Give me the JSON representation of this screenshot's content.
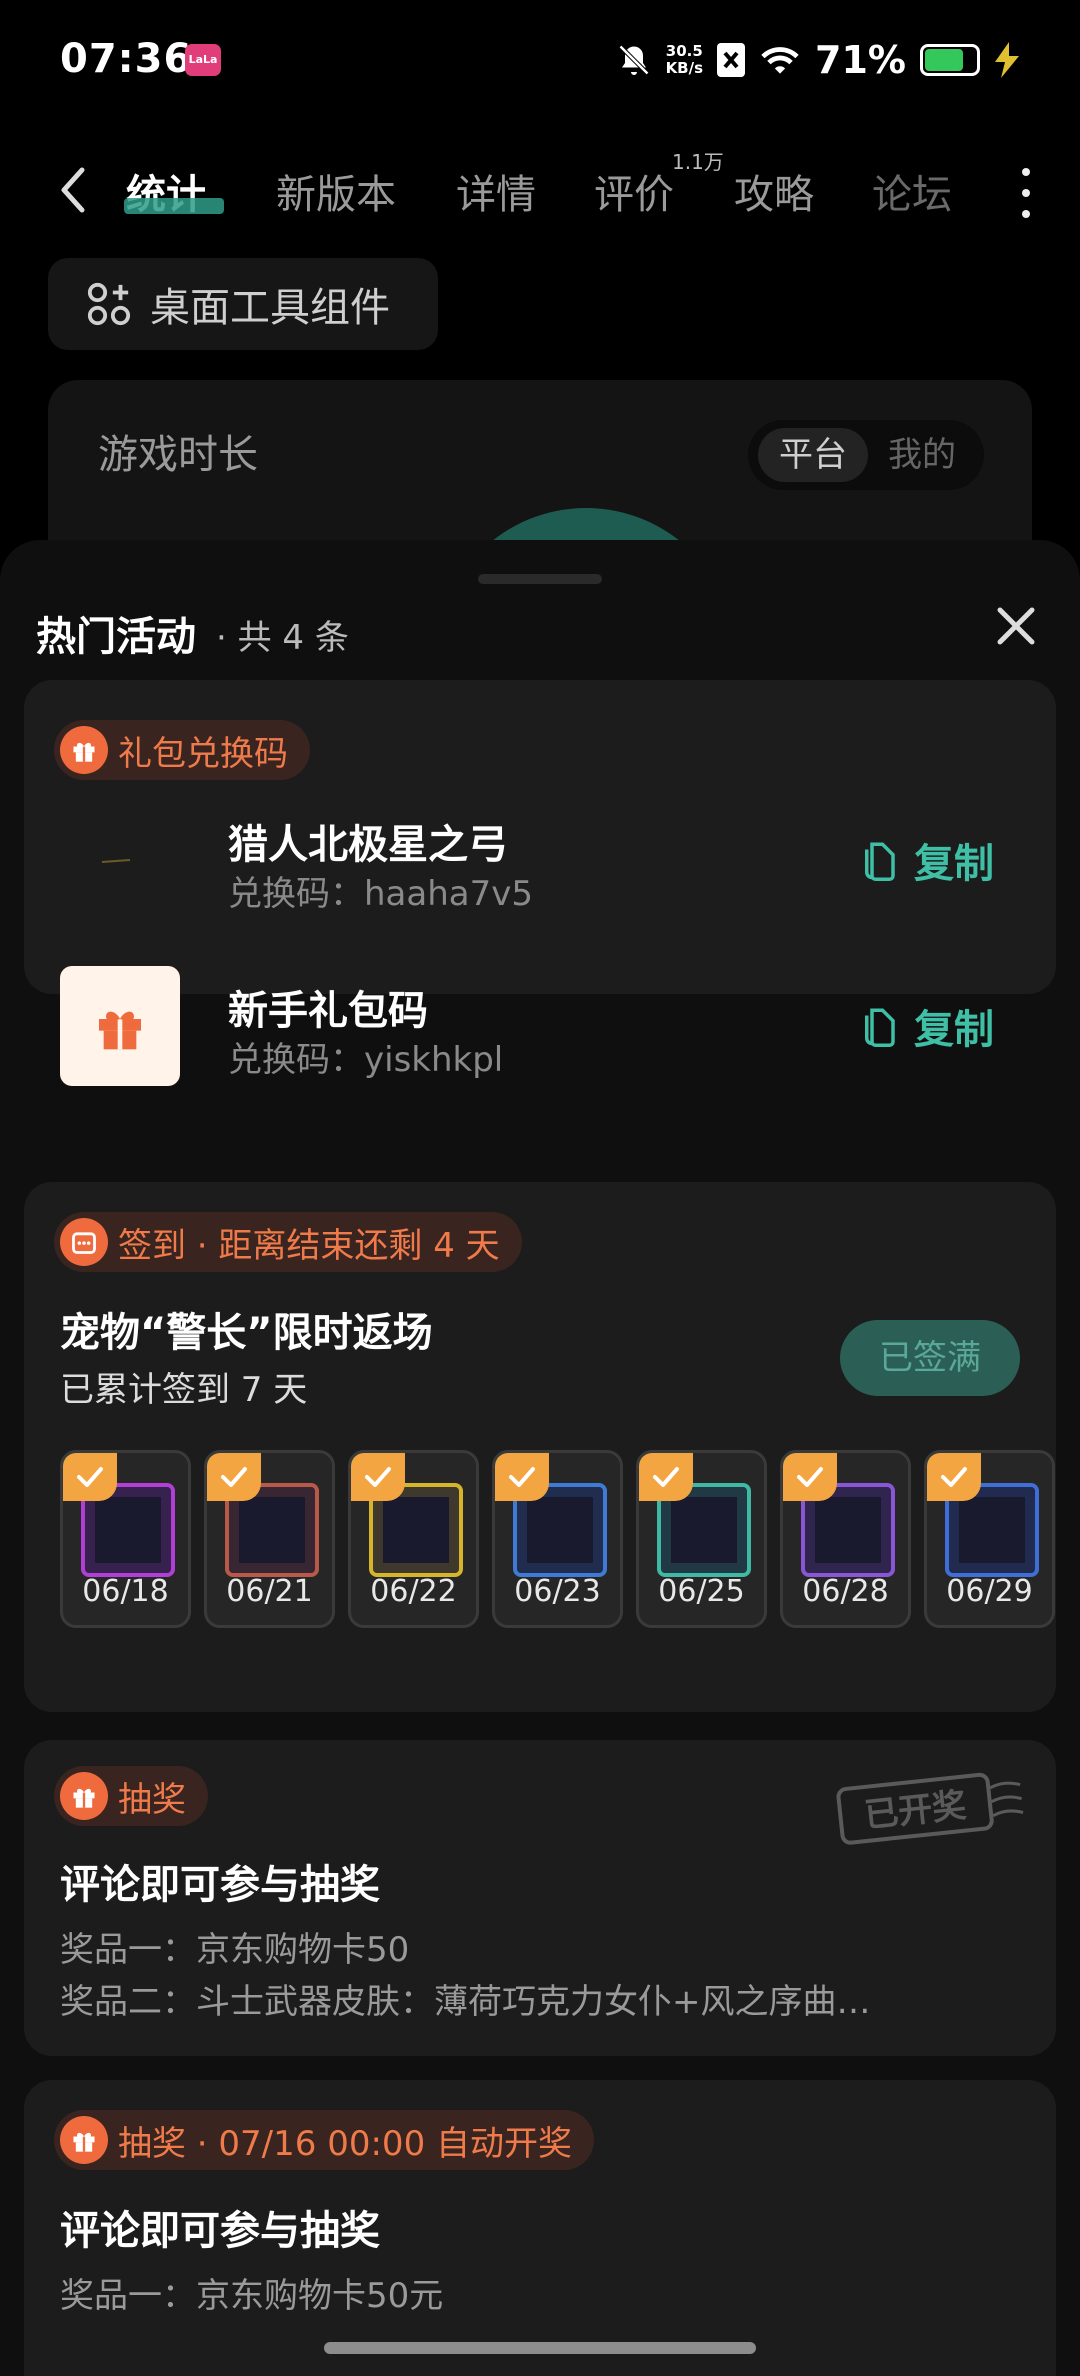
{
  "status_bar": {
    "time": "07:36",
    "net_speed_value": "30.5",
    "net_speed_unit": "KB/s",
    "battery": "71%",
    "battery_level": 0.71,
    "app_badge_text": "LaLa"
  },
  "nav": {
    "tabs": [
      {
        "label": "统计",
        "active": true
      },
      {
        "label": "新版本",
        "active": false
      },
      {
        "label": "详情",
        "active": false
      },
      {
        "label": "评价",
        "active": false,
        "badge": "1.1万"
      },
      {
        "label": "攻略",
        "active": false
      },
      {
        "label": "论坛",
        "active": false
      }
    ],
    "accent": "#2f9b87"
  },
  "widget_button": {
    "label": "桌面工具组件"
  },
  "stats_card": {
    "title": "游戏时长",
    "toggle_options": [
      "平台",
      "我的"
    ],
    "selected": "平台"
  },
  "sheet": {
    "title": "热门活动",
    "count_text": "· 共 4 条"
  },
  "gift_codes": {
    "tag": "礼包兑换码",
    "items": [
      {
        "name": "猎人北极星之弓",
        "code_label": "兑换码：haaha7v5",
        "copy": "复制"
      },
      {
        "name": "新手礼包码",
        "code_label": "兑换码：yiskhkpl",
        "copy": "复制"
      }
    ]
  },
  "checkin": {
    "tag": "签到 · 距离结束还剩 4 天",
    "title": "宠物“警长”限时返场",
    "progress_text": "已累计签到 7 天",
    "button": "已签满",
    "days": [
      {
        "date": "06/18",
        "checked": true,
        "color": "#b13fd6"
      },
      {
        "date": "06/21",
        "checked": true,
        "color": "#b85a4a"
      },
      {
        "date": "06/22",
        "checked": true,
        "color": "#d6b628"
      },
      {
        "date": "06/23",
        "checked": true,
        "color": "#3f7bd6"
      },
      {
        "date": "06/25",
        "checked": true,
        "color": "#3fb8a4"
      },
      {
        "date": "06/28",
        "checked": true,
        "color": "#8a56d6"
      },
      {
        "date": "06/29",
        "checked": true,
        "color": "#3f6fd6"
      }
    ]
  },
  "lottery_1": {
    "tag": "抽奖",
    "stamp": "已开奖",
    "title": "评论即可参与抽奖",
    "prizes": [
      "奖品一：京东购物卡50",
      "奖品二：斗士武器皮肤：薄荷巧克力女仆+风之序曲…"
    ]
  },
  "lottery_2": {
    "tag": "抽奖 · 07/16 00:00 自动开奖",
    "title": "评论即可参与抽奖",
    "prizes": [
      "奖品一：京东购物卡50元"
    ]
  },
  "colors": {
    "orange": "#ef6b3e",
    "teal": "#3ebfa6",
    "check": "#f2a541"
  }
}
